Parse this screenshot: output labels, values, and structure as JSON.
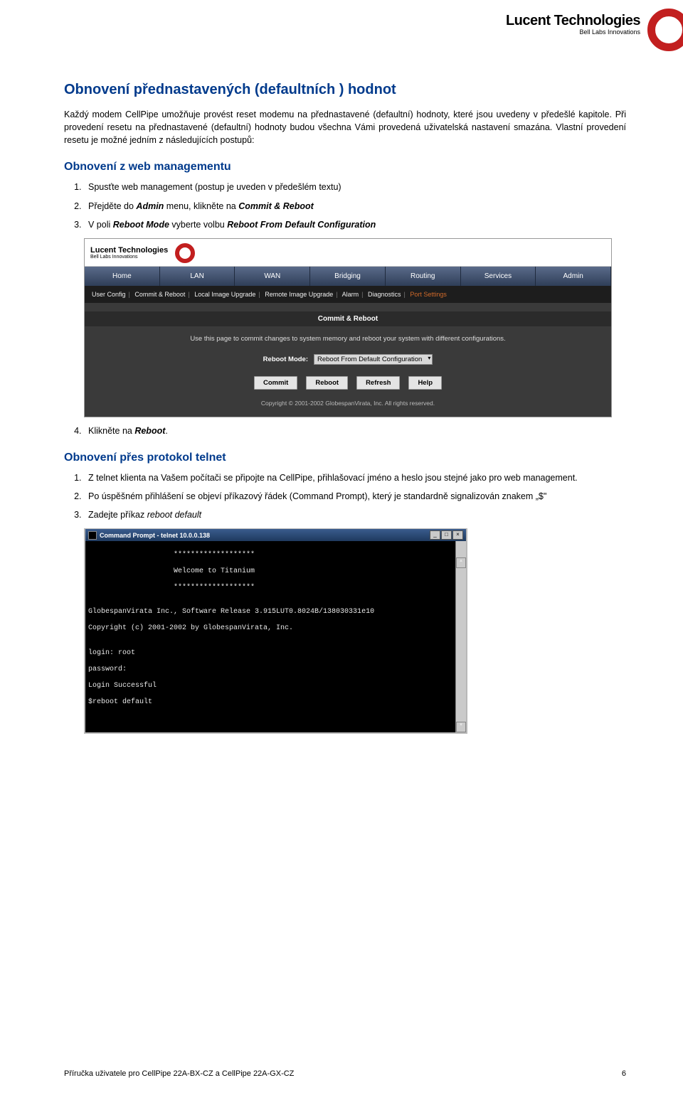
{
  "header": {
    "brand": "Lucent Technologies",
    "tagline": "Bell Labs Innovations"
  },
  "h1": "Obnovení přednastavených (defaultních ) hodnot",
  "intro1": "Každý modem CellPipe umožňuje provést reset modemu na přednastavené (defaultní) hodnoty, které jsou uvedeny v předešlé kapitole. Při provedení resetu na přednastavené (defaultní) hodnoty budou všechna Vámi provedená uživatelská nastavení smazána. Vlastní provedení resetu je možné jedním z následujících postupů:",
  "h2a": "Obnovení z web managementu",
  "steps_web": {
    "s1": "Spusťte web management (postup je uveden v předešlém textu)",
    "s2_pre": "Přejděte do ",
    "s2_admin": "Admin",
    "s2_mid": " menu, klikněte na ",
    "s2_commit": "Commit & Reboot",
    "s3_pre": "V poli ",
    "s3_rm": "Reboot Mode",
    "s3_mid": " vyberte volbu ",
    "s3_opt": "Reboot From Default Configuration",
    "s4_pre": "Klikněte na ",
    "s4_btn": "Reboot",
    "s4_post": "."
  },
  "web_ui": {
    "brand": "Lucent Technologies",
    "sub": "Bell Labs Innovations",
    "tabs": [
      "Home",
      "LAN",
      "WAN",
      "Bridging",
      "Routing",
      "Services",
      "Admin"
    ],
    "subtabs": [
      "User Config",
      "Commit & Reboot",
      "Local Image Upgrade",
      "Remote Image Upgrade",
      "Alarm",
      "Diagnostics"
    ],
    "subtab_active": "Port Settings",
    "panel_title": "Commit & Reboot",
    "desc": "Use this page to commit changes to system memory and reboot your system with different configurations.",
    "row_label": "Reboot Mode:",
    "select_value": "Reboot From Default Configuration",
    "buttons": [
      "Commit",
      "Reboot",
      "Refresh",
      "Help"
    ],
    "copyright": "Copyright © 2001-2002 GlobespanVirata, Inc. All rights reserved."
  },
  "h2b": "Obnovení přes protokol telnet",
  "steps_telnet": {
    "s1": "Z telnet klienta na Vašem počítači se připojte na CellPipe, přihlašovací jméno a heslo jsou stejné jako pro web management.",
    "s2": "Po úspěšném přihlášení se objeví příkazový řádek (Command Prompt), který je standardně signalizován znakem „$\"",
    "s3_pre": "Zadejte příkaz ",
    "s3_cmd": "reboot default"
  },
  "terminal": {
    "title": "Command Prompt - telnet 10.0.0.138",
    "lines": [
      "                    *******************",
      "                    Welcome to Titanium",
      "                    *******************",
      "",
      "GlobespanVirata Inc., Software Release 3.915LUT0.8024B/138030331e10",
      "Copyright (c) 2001-2002 by GlobespanVirata, Inc.",
      "",
      "login: root",
      "password:",
      "Login Successful",
      "$reboot default"
    ]
  },
  "footer": {
    "left": "Příručka uživatele pro CellPipe 22A-BX-CZ a CellPipe 22A-GX-CZ",
    "right": "6"
  }
}
